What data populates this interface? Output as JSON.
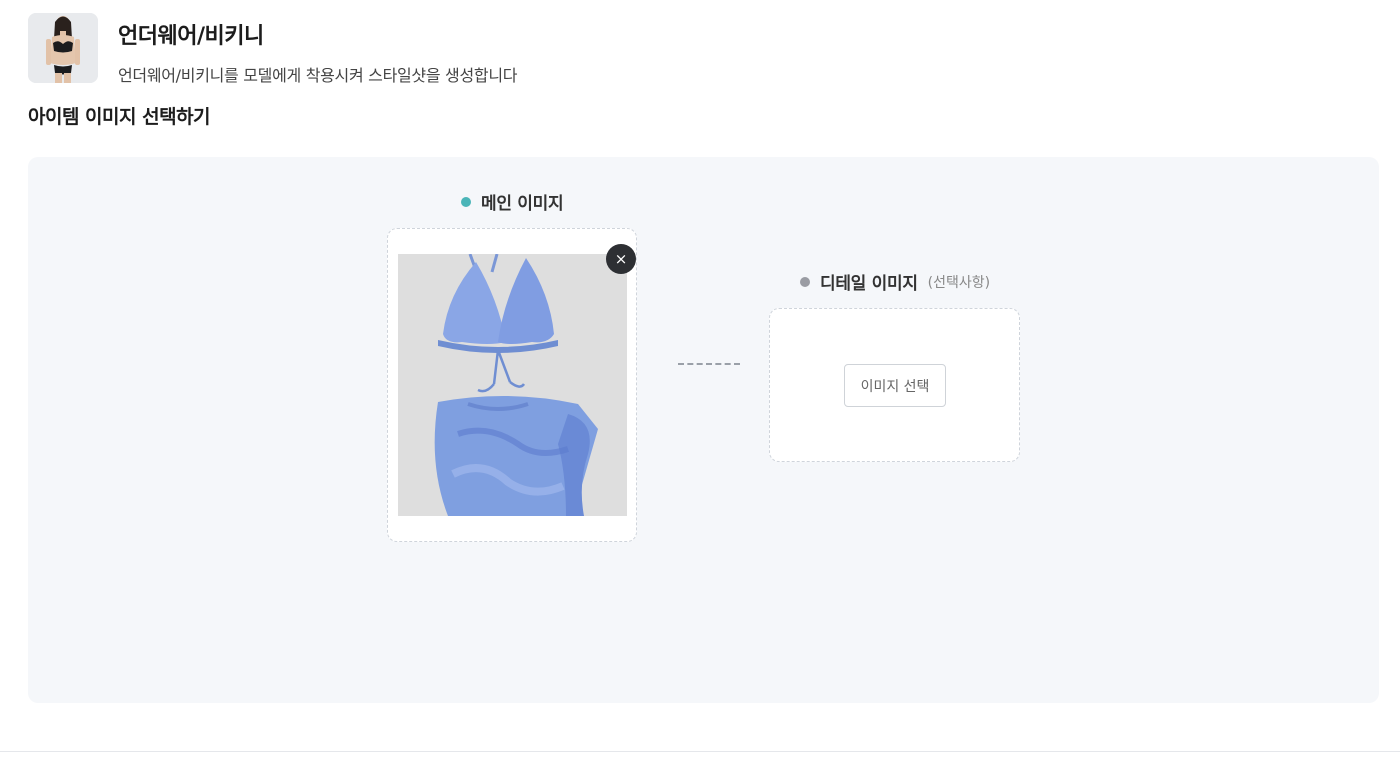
{
  "header": {
    "title": "언더웨어/비키니",
    "subtitle": "언더웨어/비키니를 모델에게 착용시켜 스타일샷을 생성합니다"
  },
  "section": {
    "title": "아이템 이미지 선택하기"
  },
  "main_image": {
    "label": "메인 이미지",
    "dot_color": "#4ab5b8",
    "remove_icon": "×"
  },
  "detail_image": {
    "label": "디테일 이미지",
    "optional": "(선택사항)",
    "dot_color": "#9a9ca3",
    "button_label": "이미지 선택"
  },
  "colors": {
    "panel_bg": "#f5f7fa",
    "bikini_blue": "#7f9fe0"
  }
}
